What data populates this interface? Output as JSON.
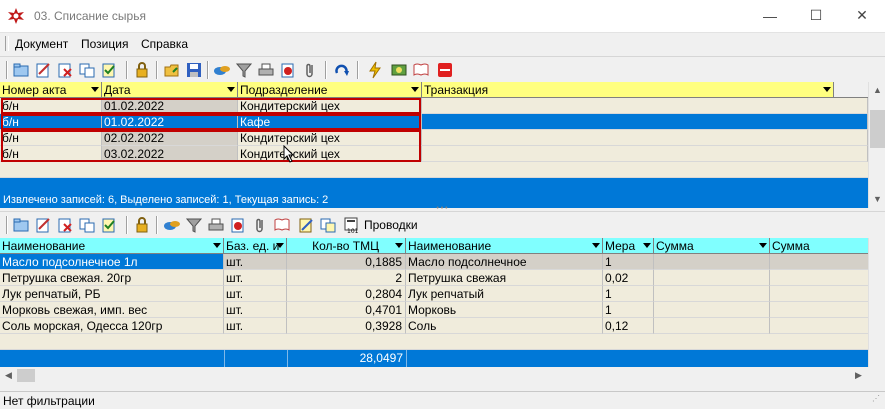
{
  "window": {
    "title": "03. Списание сырья",
    "minimize": "—",
    "maximize": "☐",
    "close": "✕"
  },
  "menu": [
    "Документ",
    "Позиция",
    "Справка"
  ],
  "top_grid": {
    "columns": [
      "Номер акта",
      "Дата",
      "Подразделение",
      "Транзакция"
    ],
    "rows": [
      [
        "б/н",
        "01.02.2022",
        "Кондитерский цех",
        ""
      ],
      [
        "б/н",
        "01.02.2022",
        "Кафе",
        ""
      ],
      [
        "б/н",
        "02.02.2022",
        "Кондитерский цех",
        ""
      ],
      [
        "б/н",
        "03.02.2022",
        "Кондитерский цех",
        ""
      ]
    ],
    "selected_row": 1,
    "status": "Извлечено записей: 6, Выделено записей: 1, Текущая запись: 2"
  },
  "bottom_toolbar": {
    "postings_label": "Проводки"
  },
  "bottom_grid": {
    "columns": [
      "Наименование",
      "Баз. ед. и",
      "Кол-во ТМЦ",
      "Наименование",
      "Мера",
      "Сумма",
      "Сумма"
    ],
    "rows": [
      [
        "Масло подсолнечное 1л",
        "шт.",
        "0,1885",
        "Масло подсолнечное",
        "1",
        "",
        ""
      ],
      [
        "Петрушка свежая. 20гр",
        "шт.",
        "2",
        "Петрушка свежая",
        "0,02",
        "",
        ""
      ],
      [
        "Лук репчатый, РБ",
        "шт.",
        "0,2804",
        "Лук репчатый",
        "1",
        "",
        ""
      ],
      [
        "Морковь свежая, имп. вес",
        "шт.",
        "0,4701",
        "Морковь",
        "1",
        "",
        ""
      ],
      [
        "Соль морская, Одесса 120гр",
        "шт.",
        "0,3928",
        "Соль",
        "0,12",
        "",
        ""
      ]
    ],
    "total": "28,0497"
  },
  "status_bar": "Нет фильтрации",
  "colors": {
    "header_yellow": "#ffff80",
    "header_cyan": "#80ffff",
    "selection_blue": "#0078d7",
    "row_beige": "#f0ecdc",
    "row_gray": "#d4d0c8",
    "highlight_red": "#c00000"
  }
}
